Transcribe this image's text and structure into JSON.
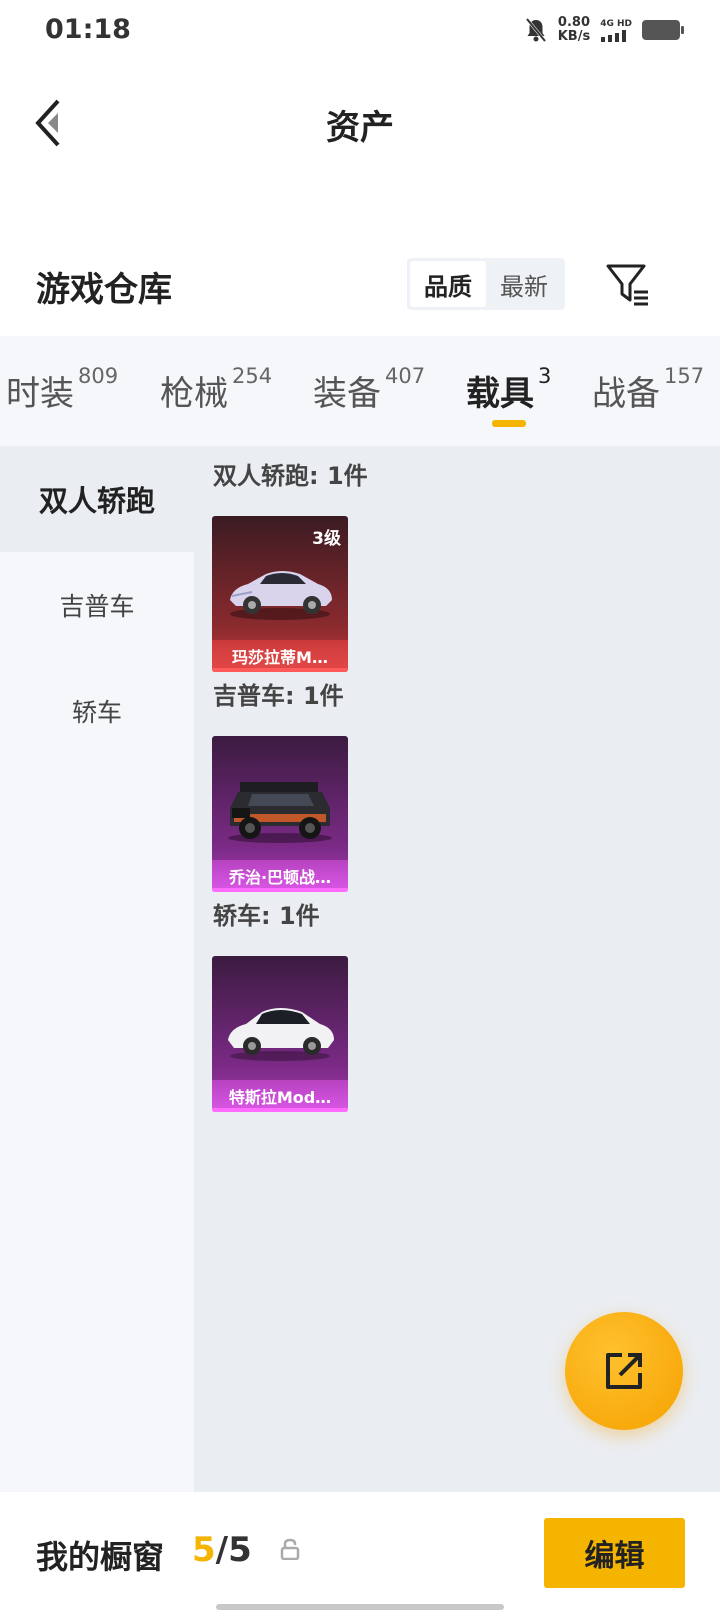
{
  "status_bar": {
    "time": "01:18",
    "net_speed_value": "0.80",
    "net_speed_unit": "KB/s",
    "net_type": "4G HD"
  },
  "header": {
    "title": "资产"
  },
  "section": {
    "title": "游戏仓库",
    "sort_options": [
      "品质",
      "最新"
    ],
    "active_sort": "品质"
  },
  "tabs": [
    {
      "label": "时装",
      "count": "809"
    },
    {
      "label": "枪械",
      "count": "254"
    },
    {
      "label": "装备",
      "count": "407"
    },
    {
      "label": "载具",
      "count": "3"
    },
    {
      "label": "战备",
      "count": "157"
    }
  ],
  "active_tab": "载具",
  "sidebar": {
    "items": [
      "双人轿跑",
      "吉普车",
      "轿车"
    ],
    "active": "双人轿跑"
  },
  "groups": [
    {
      "title": "双人轿跑: 1件",
      "items": [
        {
          "name": "玛莎拉蒂M…",
          "level": "3级",
          "rarity": "red"
        }
      ]
    },
    {
      "title": "吉普车: 1件",
      "items": [
        {
          "name": "乔治·巴顿战…",
          "level": "",
          "rarity": "purple"
        }
      ]
    },
    {
      "title": "轿车: 1件",
      "items": [
        {
          "name": "特斯拉Mod…",
          "level": "",
          "rarity": "purple"
        }
      ]
    }
  ],
  "bottom_bar": {
    "label": "我的橱窗",
    "count_current": "5",
    "count_sep": "/",
    "count_max": "5",
    "edit_label": "编辑"
  },
  "colors": {
    "accent": "#f5b400",
    "rarity_red": "#e44848",
    "rarity_purple": "#d957e6"
  }
}
